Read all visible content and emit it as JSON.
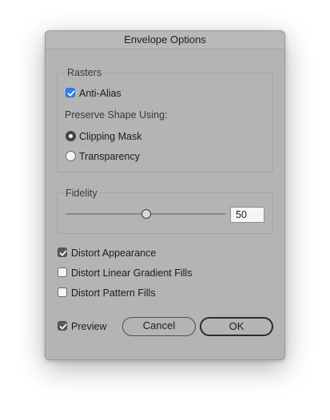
{
  "dialog": {
    "title": "Envelope Options"
  },
  "rasters": {
    "legend": "Rasters",
    "anti_alias": {
      "label": "Anti-Alias",
      "checked": true
    },
    "preserve_shape_label": "Preserve Shape Using:",
    "options": [
      {
        "label": "Clipping Mask",
        "selected": true
      },
      {
        "label": "Transparency",
        "selected": false
      }
    ]
  },
  "fidelity": {
    "legend": "Fidelity",
    "value": "50",
    "min": 0,
    "max": 100
  },
  "checkboxes": [
    {
      "label": "Distort Appearance",
      "checked": true
    },
    {
      "label": "Distort Linear Gradient Fills",
      "checked": false
    },
    {
      "label": "Distort Pattern Fills",
      "checked": false
    }
  ],
  "footer": {
    "preview": {
      "label": "Preview",
      "checked": true
    },
    "cancel_label": "Cancel",
    "ok_label": "OK"
  },
  "colors": {
    "dialog_bg": "#b4b4b4",
    "accent_checkbox": "#2f7ff5"
  }
}
